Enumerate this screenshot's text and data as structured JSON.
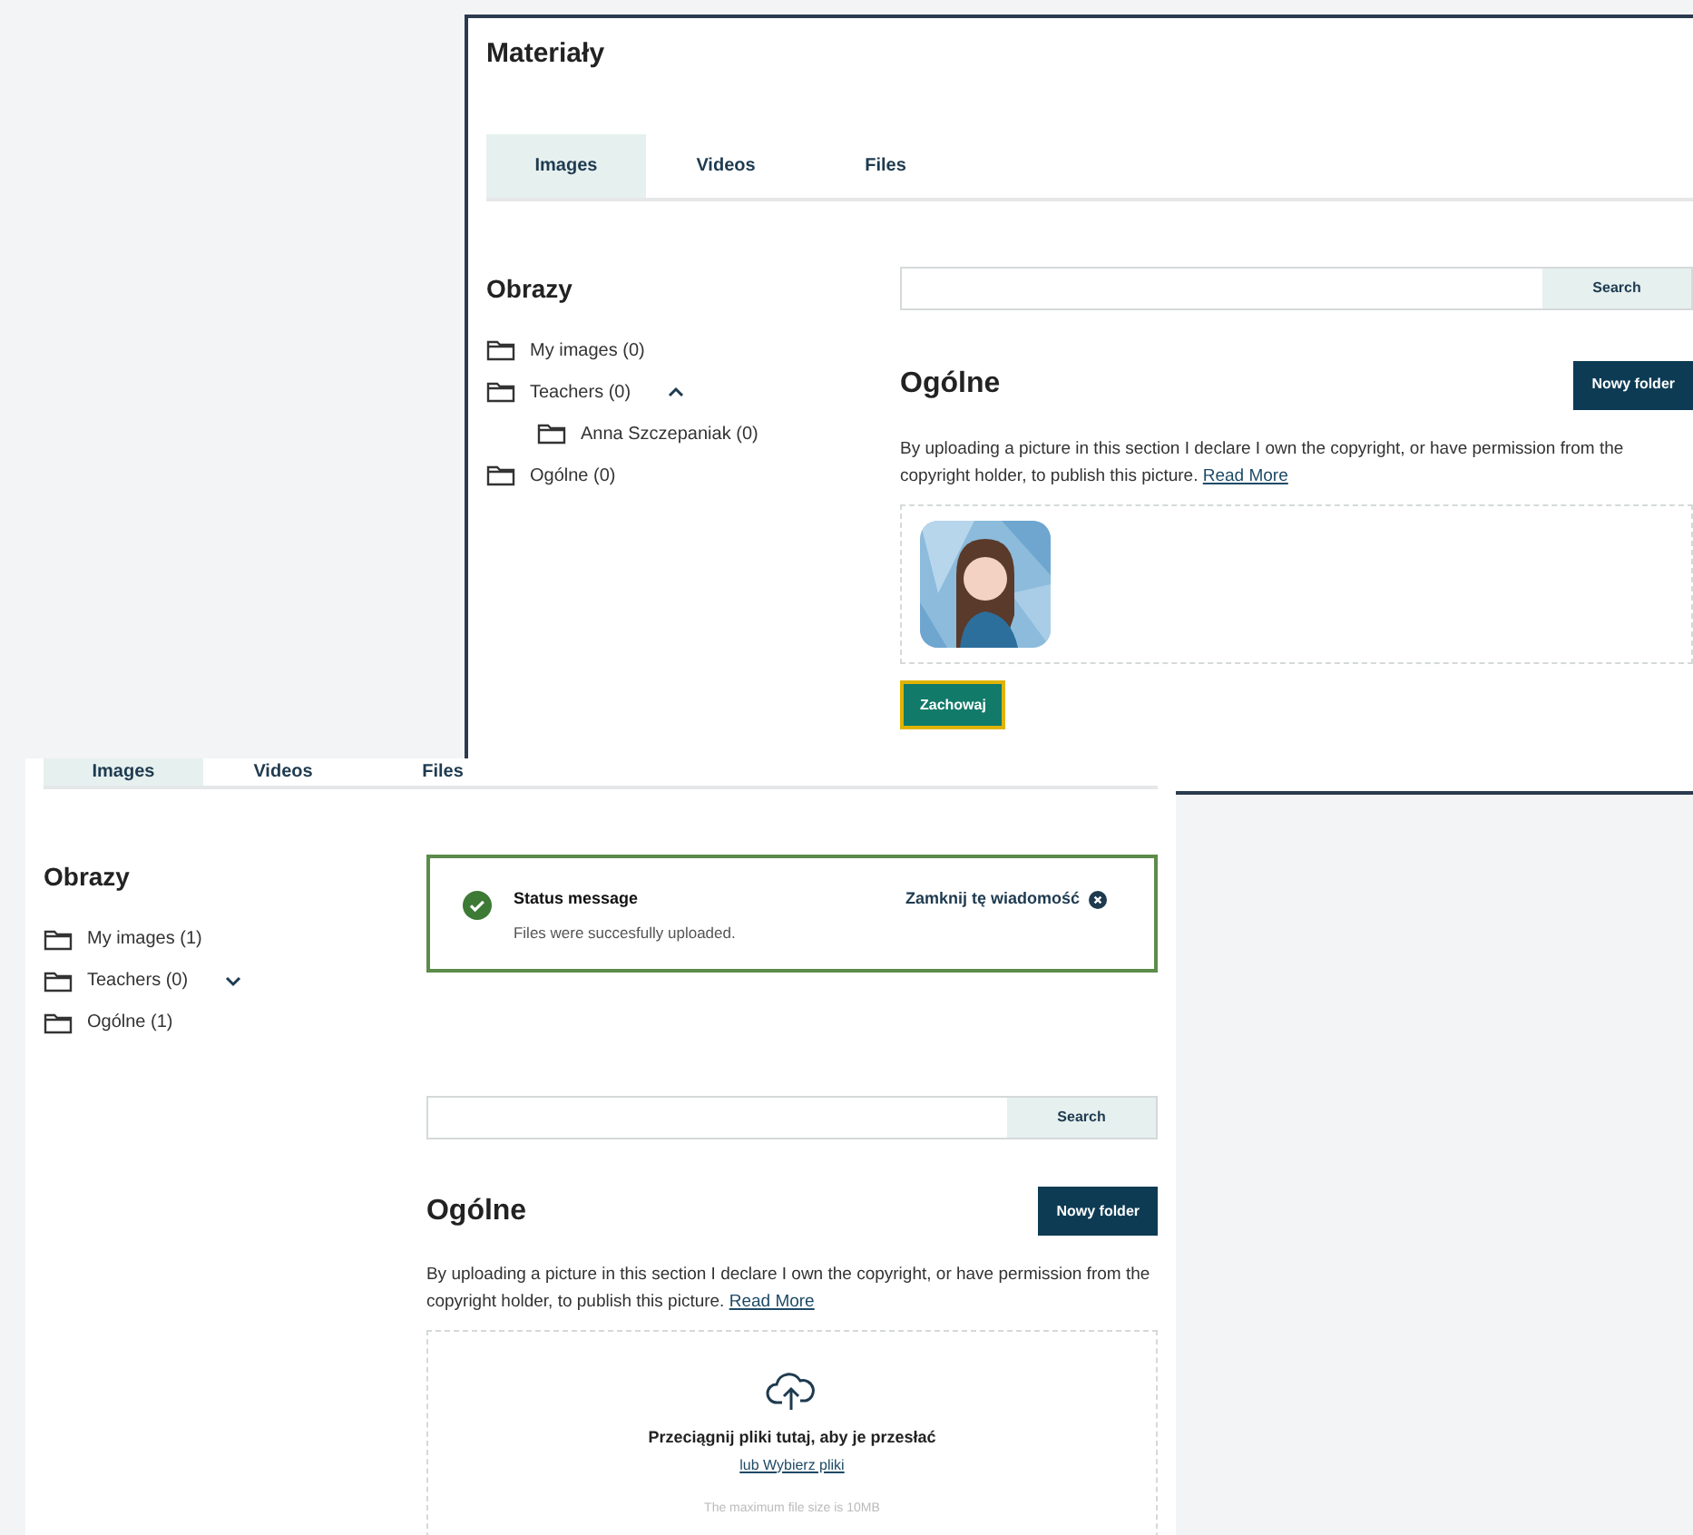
{
  "panels": [
    {
      "title": "Materiały",
      "tabs": [
        {
          "label": "Images",
          "selected": true
        },
        {
          "label": "Videos",
          "selected": false
        },
        {
          "label": "Files",
          "selected": false
        }
      ],
      "sidebar": {
        "heading": "Obrazy",
        "folders": [
          {
            "label": "My images (0)"
          },
          {
            "label": "Teachers (0)",
            "expanded": true,
            "children": [
              {
                "label": "Anna Szczepaniak (0)"
              }
            ]
          },
          {
            "label": "Ogólne (0)"
          }
        ]
      },
      "search": {
        "button": "Search"
      },
      "section": {
        "title": "Ogólne",
        "new_folder": "Nowy folder",
        "notice": "By uploading a picture in this section I declare I own the copyright, or have permission from the copyright holder, to publish this picture.",
        "read_more": "Read More"
      },
      "save_button": "Zachowaj"
    },
    {
      "tabs": [
        {
          "label": "Images",
          "selected": true
        },
        {
          "label": "Videos",
          "selected": false
        },
        {
          "label": "Files",
          "selected": false
        }
      ],
      "sidebar": {
        "heading": "Obrazy",
        "folders": [
          {
            "label": "My images (1)"
          },
          {
            "label": "Teachers (0)",
            "expanded": false
          },
          {
            "label": "Ogólne (1)"
          }
        ]
      },
      "status": {
        "title": "Status message",
        "text": "Files were succesfully uploaded.",
        "close": "Zamknij tę wiadomość"
      },
      "search": {
        "button": "Search"
      },
      "section": {
        "title": "Ogólne",
        "new_folder": "Nowy folder",
        "notice": "By uploading a picture in this section I declare I own the copyright, or have permission from the copyright holder, to publish this picture.",
        "read_more": "Read More"
      },
      "dropzone": {
        "title": "Przeciągnij pliki tutaj, aby je przesłać",
        "link": "lub Wybierz pliki",
        "hint": "The maximum file size is 10MB"
      }
    }
  ]
}
